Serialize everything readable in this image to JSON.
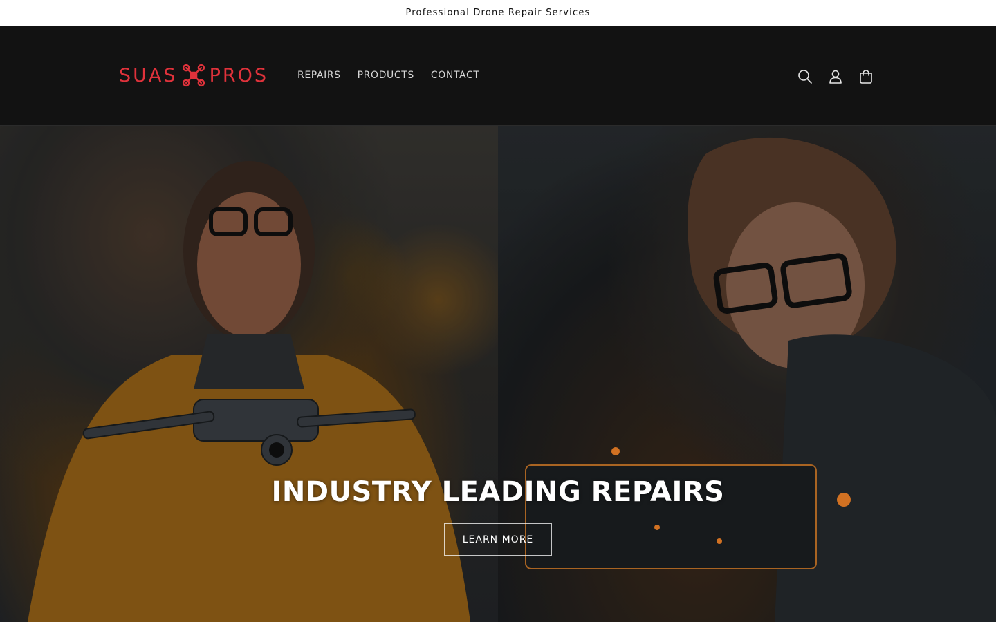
{
  "announcement": {
    "text": "Professional Drone Repair Services"
  },
  "header": {
    "logo": {
      "text_left": "SUAS",
      "text_right": "PROS",
      "color": "#e0323b"
    },
    "nav": [
      {
        "label": "REPAIRS"
      },
      {
        "label": "PRODUCTS"
      },
      {
        "label": "CONTACT"
      }
    ],
    "icons": [
      "search-icon",
      "account-icon",
      "cart-icon"
    ]
  },
  "hero": {
    "title": "INDUSTRY LEADING REPAIRS",
    "button_label": "LEARN MORE"
  },
  "colors": {
    "header_bg": "#121212",
    "announcement_bg": "#ffffff",
    "brand_red": "#e0323b"
  }
}
